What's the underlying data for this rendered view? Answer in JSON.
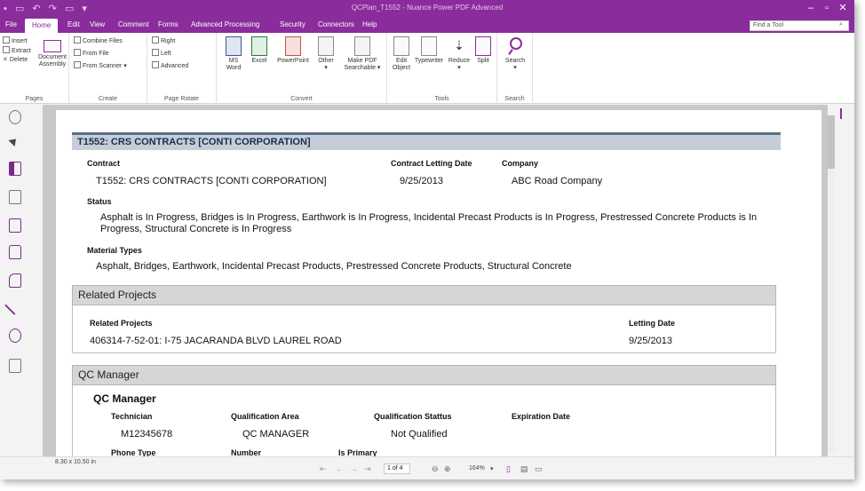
{
  "window": {
    "title": "QCPlan_T1552 - Nuance Power PDF Advanced"
  },
  "menu": {
    "tabs": [
      "File",
      "Home",
      "Edit",
      "View",
      "Comment",
      "Forms",
      "Advanced Processing",
      "Security",
      "Connectors",
      "Help"
    ],
    "active": "Home",
    "find_placeholder": "Find a Tool"
  },
  "ribbon": {
    "pages": {
      "label": "Pages",
      "insert": "Insert",
      "extract": "Extract",
      "delete": "Delete",
      "doc_assembly_1": "Document",
      "doc_assembly_2": "Assembly"
    },
    "create": {
      "label": "Create",
      "combine": "Combine Files",
      "from_file": "From File",
      "from_scanner": "From Scanner"
    },
    "rotate": {
      "label": "Page Rotate",
      "right": "Right",
      "left": "Left",
      "advanced": "Advanced"
    },
    "convert": {
      "label": "Convert",
      "ms_word_1": "MS",
      "ms_word_2": "Word",
      "excel": "Excel",
      "powerpoint": "PowerPoint",
      "other": "Other",
      "make_pdf_1": "Make PDF",
      "make_pdf_2": "Searchable"
    },
    "tools": {
      "label": "Tools",
      "edit_object_1": "Edit",
      "edit_object_2": "Object",
      "typewriter": "Typewriter",
      "reduce": "Reduce",
      "split": "Split"
    },
    "search": {
      "label": "Search",
      "button": "Search"
    }
  },
  "document": {
    "section_title": "T1552: CRS CONTRACTS [CONTI CORPORATION]",
    "contract_label": "Contract",
    "contract_value": "T1552: CRS CONTRACTS [CONTI CORPORATION]",
    "letting_label": "Contract Letting Date",
    "letting_value": "9/25/2013",
    "company_label": "Company",
    "company_value": "ABC Road Company",
    "status_label": "Status",
    "status_value": "Asphalt is In Progress, Bridges is In Progress, Earthwork is In Progress, Incidental Precast Products is In Progress, Prestressed Concrete Products is In Progress, Structural Concrete is In Progress",
    "material_label": "Material Types",
    "material_value": "Asphalt, Bridges, Earthwork, Incidental Precast Products, Prestressed Concrete Products, Structural Concrete",
    "related": {
      "header": "Related Projects",
      "col_projects": "Related Projects",
      "col_letting": "Letting Date",
      "project": "406314-7-52-01: I-75 JACARANDA BLVD LAUREL ROAD",
      "letting": "9/25/2013"
    },
    "qc": {
      "header": "QC Manager",
      "subheader": "QC Manager",
      "col_tech": "Technician",
      "col_area": "Qualification Area",
      "col_status": "Qualification Stattus",
      "col_exp": "Expiration Date",
      "tech": "M12345678",
      "area": "QC MANAGER",
      "status": "Not Qualified",
      "col_phone": "Phone Type",
      "col_number": "Number",
      "col_primary": "Is Primary"
    }
  },
  "status": {
    "page_size": "8.30 x 10.50 in",
    "page_field": "1 of 4",
    "zoom": "164%"
  },
  "colors": {
    "accent": "#8b2c9c",
    "section": "#c5cdd9"
  }
}
